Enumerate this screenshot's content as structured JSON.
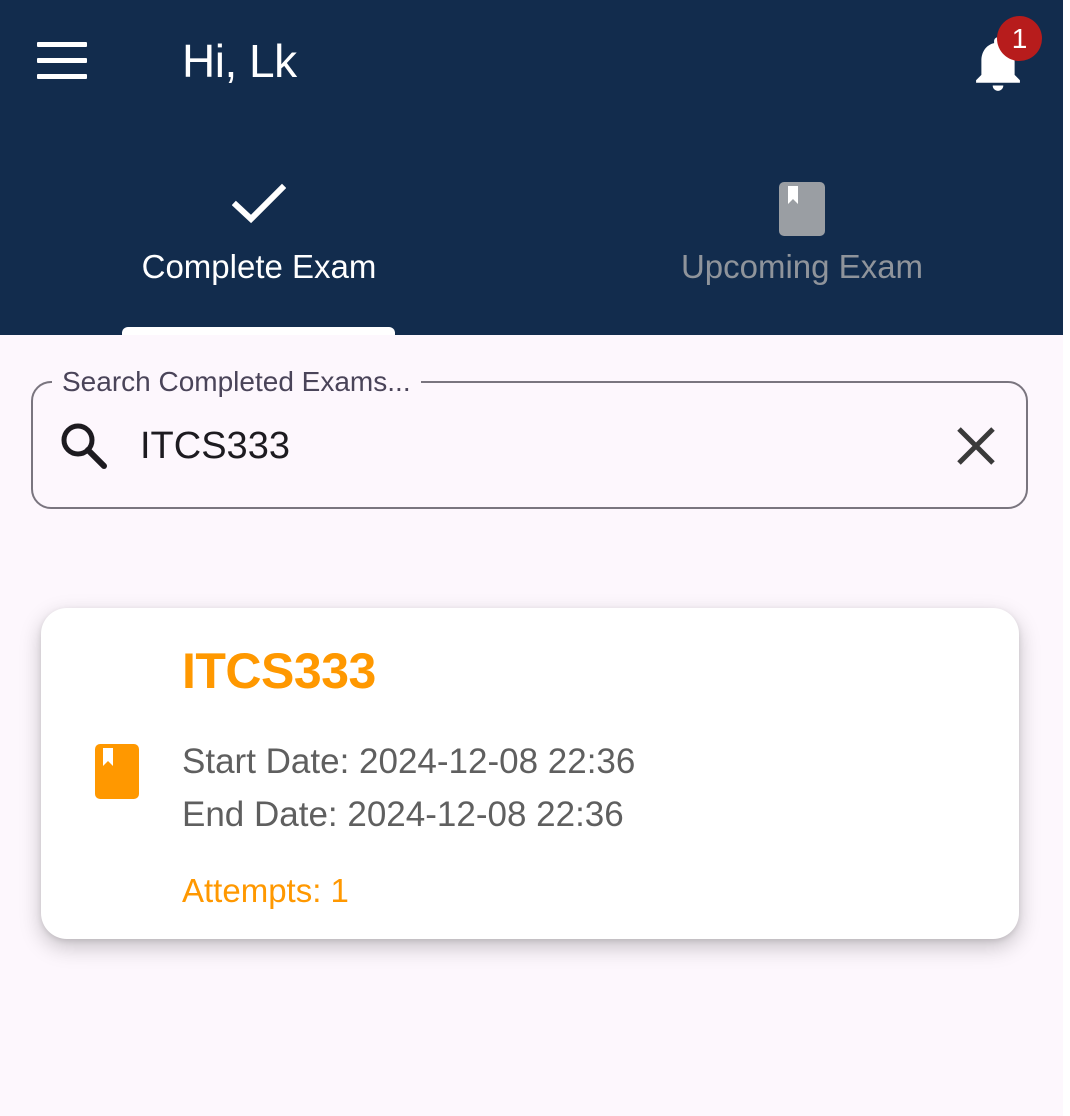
{
  "header": {
    "greeting": "Hi, Lk",
    "notification_count": "1",
    "bar_color": "#122c4d"
  },
  "tabs": [
    {
      "label": "Complete Exam",
      "icon": "check-icon",
      "selected": true
    },
    {
      "label": "Upcoming Exam",
      "icon": "book-icon",
      "selected": false
    }
  ],
  "search": {
    "label": "Search Completed Exams...",
    "value": "ITCS333"
  },
  "exams": [
    {
      "title": "ITCS333",
      "start_date": "Start Date: 2024-12-08 22:36",
      "end_date": "End Date: 2024-12-08 22:36",
      "attempts": "Attempts: 1",
      "icon": "book-icon"
    }
  ],
  "colors": {
    "accent": "#ff9800",
    "badge": "#b71c1c",
    "background": "#fdf7fd"
  }
}
